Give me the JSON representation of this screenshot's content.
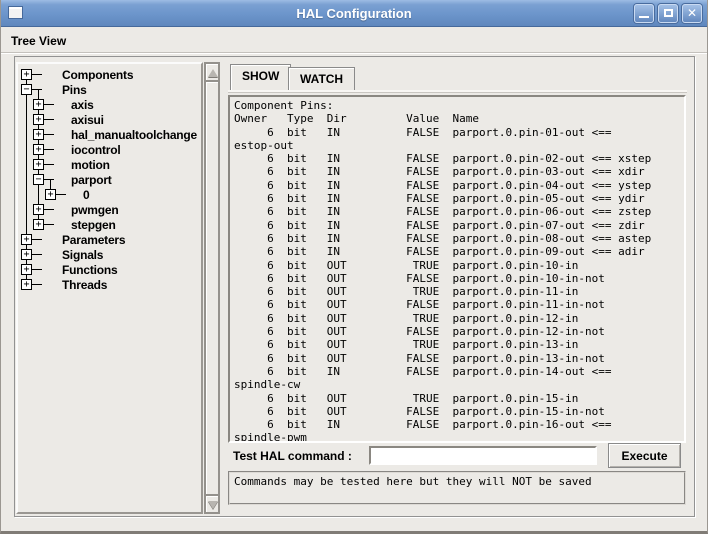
{
  "window": {
    "title": "HAL Configuration",
    "controls": {
      "minimize_icon": "minimize-icon",
      "maximize_icon": "maximize-icon",
      "close_icon": "close-icon"
    }
  },
  "colors": {
    "titlebar_top": "#9DBCE4",
    "titlebar_bottom": "#5F87BD",
    "titlebar_border": "#46699B",
    "window_bg": "#ECEAE6",
    "title_text": "#FFFFFF",
    "text": "#000000",
    "trough": "#E6E3DE"
  },
  "menu": {
    "items": [
      {
        "label": "Tree View"
      }
    ]
  },
  "tree": {
    "items": [
      {
        "label": "Components",
        "depth": 0,
        "sign": "+"
      },
      {
        "label": "Pins",
        "depth": 0,
        "sign": "−"
      },
      {
        "label": "axis",
        "depth": 1,
        "sign": "+"
      },
      {
        "label": "axisui",
        "depth": 1,
        "sign": "+"
      },
      {
        "label": "hal_manualtoolchange",
        "depth": 1,
        "sign": "+"
      },
      {
        "label": "iocontrol",
        "depth": 1,
        "sign": "+"
      },
      {
        "label": "motion",
        "depth": 1,
        "sign": "+"
      },
      {
        "label": "parport",
        "depth": 1,
        "sign": "−"
      },
      {
        "label": "0",
        "depth": 2,
        "sign": "+"
      },
      {
        "label": "pwmgen",
        "depth": 1,
        "sign": "+"
      },
      {
        "label": "stepgen",
        "depth": 1,
        "sign": "+"
      },
      {
        "label": "Parameters",
        "depth": 0,
        "sign": "+"
      },
      {
        "label": "Signals",
        "depth": 0,
        "sign": "+"
      },
      {
        "label": "Functions",
        "depth": 0,
        "sign": "+"
      },
      {
        "label": "Threads",
        "depth": 0,
        "sign": "+"
      }
    ]
  },
  "tabs": {
    "show_label": "SHOW",
    "watch_label": "WATCH",
    "active": "SHOW"
  },
  "show_output": {
    "lines": [
      "Component Pins:",
      "Owner   Type  Dir         Value  Name",
      "     6  bit   IN          FALSE  parport.0.pin-01-out <==",
      "estop-out",
      "     6  bit   IN          FALSE  parport.0.pin-02-out <== xstep",
      "     6  bit   IN          FALSE  parport.0.pin-03-out <== xdir",
      "     6  bit   IN          FALSE  parport.0.pin-04-out <== ystep",
      "     6  bit   IN          FALSE  parport.0.pin-05-out <== ydir",
      "     6  bit   IN          FALSE  parport.0.pin-06-out <== zstep",
      "     6  bit   IN          FALSE  parport.0.pin-07-out <== zdir",
      "     6  bit   IN          FALSE  parport.0.pin-08-out <== astep",
      "     6  bit   IN          FALSE  parport.0.pin-09-out <== adir",
      "     6  bit   OUT          TRUE  parport.0.pin-10-in",
      "     6  bit   OUT         FALSE  parport.0.pin-10-in-not",
      "     6  bit   OUT          TRUE  parport.0.pin-11-in",
      "     6  bit   OUT         FALSE  parport.0.pin-11-in-not",
      "     6  bit   OUT          TRUE  parport.0.pin-12-in",
      "     6  bit   OUT         FALSE  parport.0.pin-12-in-not",
      "     6  bit   OUT          TRUE  parport.0.pin-13-in",
      "     6  bit   OUT         FALSE  parport.0.pin-13-in-not",
      "     6  bit   IN          FALSE  parport.0.pin-14-out <==",
      "spindle-cw",
      "     6  bit   OUT          TRUE  parport.0.pin-15-in",
      "     6  bit   OUT         FALSE  parport.0.pin-15-in-not",
      "     6  bit   IN          FALSE  parport.0.pin-16-out <==",
      "spindle-pwm"
    ]
  },
  "command": {
    "label": "Test HAL command :",
    "input_value": "",
    "execute_label": "Execute"
  },
  "message": {
    "text": "Commands may be tested here but they will NOT be saved"
  }
}
